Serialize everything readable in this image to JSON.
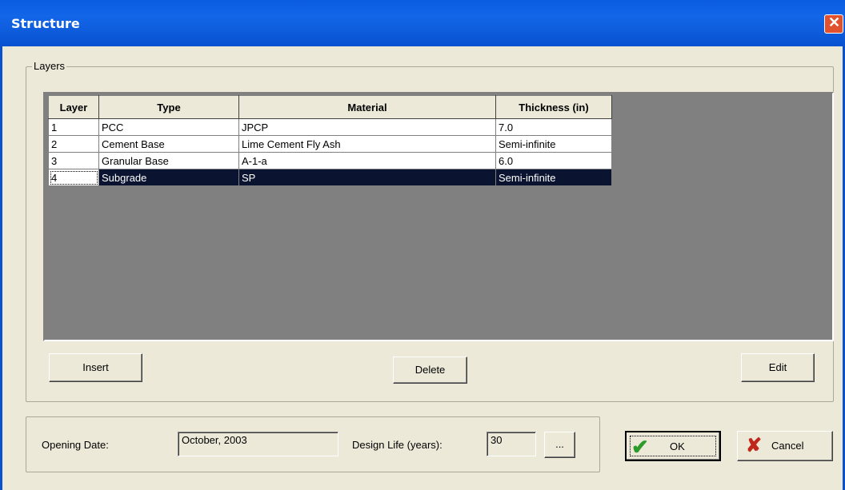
{
  "window": {
    "title": "Structure",
    "close_icon": "close-icon"
  },
  "layers_group": {
    "legend": "Layers",
    "columns": [
      "Layer",
      "Type",
      "Material",
      "Thickness (in)"
    ],
    "rows": [
      {
        "layer": "1",
        "type": "PCC",
        "material": "JPCP",
        "thickness": "7.0"
      },
      {
        "layer": "2",
        "type": "Cement Base",
        "material": "Lime Cement Fly Ash",
        "thickness": "Semi-infinite"
      },
      {
        "layer": "3",
        "type": "Granular Base",
        "material": "A-1-a",
        "thickness": "6.0"
      },
      {
        "layer": "4",
        "type": "Subgrade",
        "material": "SP",
        "thickness": "Semi-infinite"
      }
    ],
    "selected_row": 4,
    "insert_label": "Insert",
    "delete_label": "Delete",
    "edit_label": "Edit"
  },
  "footer": {
    "opening_date_label": "Opening Date:",
    "opening_date_value": "October, 2003",
    "design_life_label": "Design Life (years):",
    "design_life_value": "30",
    "browse_label": "...",
    "ok_label": "OK",
    "cancel_label": "Cancel"
  },
  "colors": {
    "title_bar": "#0a5be0",
    "selection": "#0a1430",
    "ok_check": "#2c9b2c",
    "cancel_x": "#c0281c"
  }
}
